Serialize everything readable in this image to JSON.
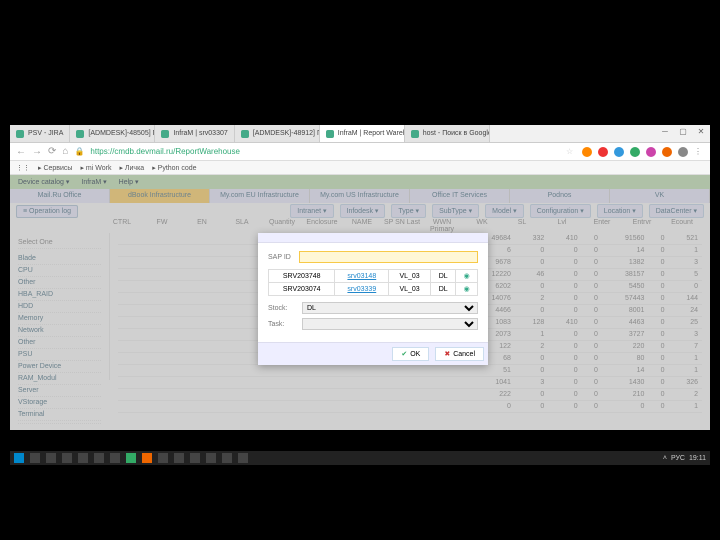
{
  "browser": {
    "tabs": [
      {
        "label": "PSV - JIRA"
      },
      {
        "label": "[ADMDESK]-48505] Под..."
      },
      {
        "label": "InfraM | srv03307"
      },
      {
        "label": "[ADMDESK]-48912] Под..."
      },
      {
        "label": "InfraM | Report Wareh...",
        "active": true
      },
      {
        "label": "host - Поиск в Google"
      }
    ],
    "url": "https://cmdb.devmail.ru/ReportWarehouse",
    "bookmarks": [
      "Сервисы",
      "mi Work",
      "Личка",
      "Python code"
    ]
  },
  "page": {
    "menu": [
      "Device catalog ▾",
      "InfraM ▾",
      "Help ▾"
    ],
    "sections": [
      "Mail.Ru Office",
      "dBook Infrastructure",
      "My.com EU Infrastructure",
      "My.com US Infrastructure",
      "Office IT Services",
      "Podnos",
      "VK"
    ],
    "operationBtn": "Operation log",
    "filters": [
      "Intranet ▾",
      "Infodesk ▾",
      "Type ▾",
      "SubType ▾",
      "Model ▾",
      "Configuration ▾",
      "Location ▾",
      "DataCenter ▾"
    ],
    "gridHeaders": [
      "CTRL",
      "FW",
      "EN",
      "SLA",
      "Quantity",
      "Enclosure",
      "NAME",
      "SP SN Last",
      "WWN Primary",
      "WK",
      "SL",
      "Lvl",
      "Enter",
      "Entrvr",
      "Ecount"
    ],
    "sidebar": {
      "label": "Select One",
      "items": [
        "Blade",
        "CPU",
        "Other",
        "HBA_RAID",
        "HDD",
        "Memory",
        "Network",
        "Other",
        "PSU",
        "Power Device",
        "RAM_Modul",
        "Server",
        "VStorage",
        "Terminal"
      ]
    },
    "rows": [
      [
        49684,
        332,
        410,
        0,
        91560,
        0,
        521
      ],
      [
        6,
        0,
        0,
        0,
        14,
        0,
        1
      ],
      [
        9678,
        0,
        0,
        0,
        1382,
        0,
        3
      ],
      [
        12220,
        46,
        0,
        0,
        38157,
        0,
        5
      ],
      [
        6202,
        0,
        0,
        0,
        5450,
        0,
        0
      ],
      [
        14076,
        2,
        0,
        0,
        57443,
        0,
        144
      ],
      [
        4466,
        0,
        0,
        0,
        8001,
        0,
        24
      ],
      [
        1083,
        128,
        410,
        0,
        4463,
        0,
        25
      ],
      [
        2073,
        1,
        0,
        0,
        3727,
        0,
        3
      ],
      [
        122,
        2,
        0,
        0,
        220,
        0,
        7
      ],
      [
        68,
        0,
        0,
        0,
        80,
        0,
        1
      ],
      [
        51,
        0,
        0,
        0,
        14,
        0,
        1
      ],
      [
        1041,
        3,
        0,
        0,
        1430,
        0,
        326
      ],
      [
        222,
        0,
        0,
        0,
        210,
        0,
        2
      ],
      [
        0,
        0,
        0,
        0,
        0,
        0,
        1
      ]
    ]
  },
  "modal": {
    "sapIdLabel": "SAP ID",
    "cols": [
      "",
      "",
      "",
      ""
    ],
    "rows": [
      {
        "id": "SRV203748",
        "srv": "srv03148",
        "loc": "VL_03",
        "mfr": "DL"
      },
      {
        "id": "SRV203074",
        "srv": "srv03339",
        "loc": "VL_03",
        "mfr": "DL"
      }
    ],
    "stockLabel": "Stock:",
    "stockValue": "DL",
    "taskLabel": "Task:",
    "taskValue": "",
    "ok": "OK",
    "cancel": "Cancel"
  },
  "taskbar": {
    "time": "19:11",
    "lang": "РУС"
  }
}
